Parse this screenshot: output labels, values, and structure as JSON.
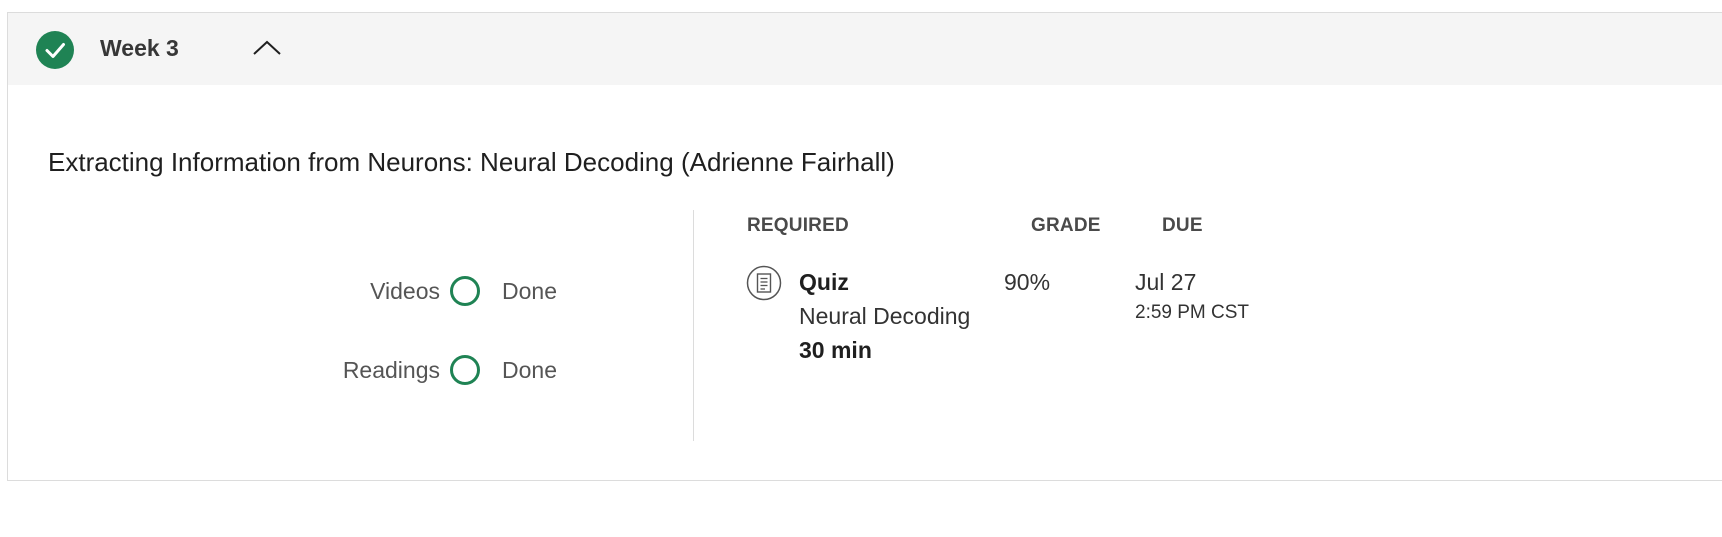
{
  "week": {
    "title": "Week 3",
    "completed": true,
    "expanded": true,
    "icons": {
      "status": "check-circle-icon",
      "toggle": "chevron-up-icon"
    }
  },
  "module": {
    "title": "Extracting Information from Neurons: Neural Decoding (Adrienne Fairhall)"
  },
  "progress": [
    {
      "label": "Videos",
      "status": "Done"
    },
    {
      "label": "Readings",
      "status": "Done"
    }
  ],
  "columns": {
    "required": "REQUIRED",
    "grade": "GRADE",
    "due": "DUE"
  },
  "items": [
    {
      "icon": "quiz-icon",
      "type": "Quiz",
      "name": "Neural Decoding",
      "duration": "30 min",
      "grade": "90%",
      "due_date": "Jul 27",
      "due_time": "2:59 PM CST"
    }
  ],
  "colors": {
    "accent": "#1f8354",
    "header_bg": "#f5f5f5",
    "border": "#dcdcdc"
  }
}
